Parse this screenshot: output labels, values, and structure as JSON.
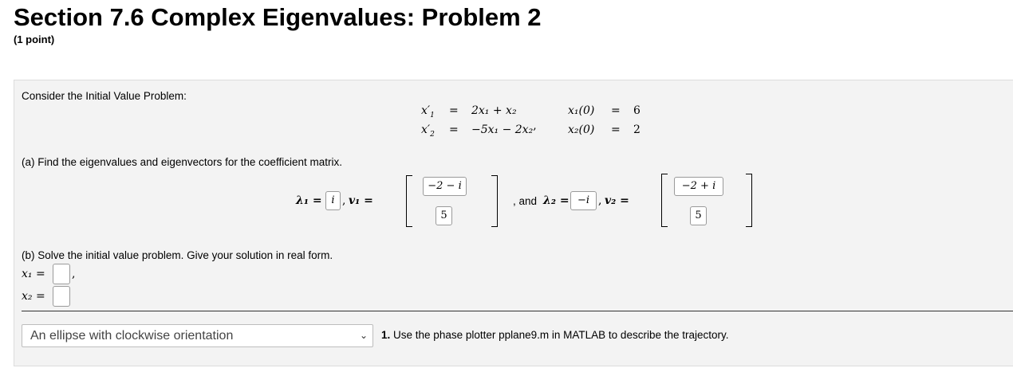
{
  "header": {
    "title": "Section 7.6 Complex Eigenvalues: Problem 2",
    "points": "(1 point)"
  },
  "problem": {
    "intro": "Consider the Initial Value Problem:",
    "system": {
      "eq1_lhs": "x′",
      "eq1_lhs_sub": "1",
      "eq1_rhs": "2x₁ + x₂",
      "eq2_lhs": "x′",
      "eq2_lhs_sub": "2",
      "eq2_rhs": "−5x₁ − 2x₂",
      "eq2_suffix": ",",
      "ic1_lhs": "x₁(0)",
      "ic1_rhs": "6",
      "ic2_lhs": "x₂(0)",
      "ic2_rhs": "2",
      "equals": "="
    },
    "part_a": {
      "prompt": "(a) Find the eigenvalues and eigenvectors for the coefficient matrix.",
      "lambda1_label": "λ₁ =",
      "lambda1_value": "i",
      "v1_label": "v₁ =",
      "v1_entries": [
        "−2 − i",
        "5"
      ],
      "and_text": ", and",
      "lambda2_label": "λ₂ =",
      "lambda2_value": "−i",
      "v2_label": "v₂ =",
      "v2_entries": [
        "−2 + i",
        "5"
      ],
      "comma": ","
    },
    "part_b": {
      "prompt": "(b) Solve the initial value problem. Give your solution in real form.",
      "x1_label": "x₁ =",
      "x1_value": "",
      "x2_label": "x₂ =",
      "x2_value": ""
    },
    "trajectory": {
      "selected_option": "An ellipse with clockwise orientation",
      "instruction_number": "1.",
      "instruction": "Use the phase plotter pplane9.m in MATLAB to describe the trajectory."
    }
  }
}
